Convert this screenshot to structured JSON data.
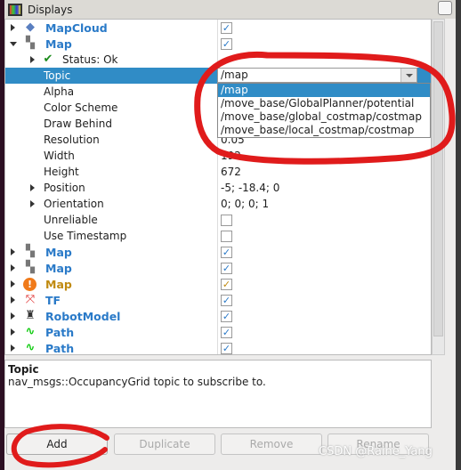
{
  "window": {
    "title": "Displays"
  },
  "tree": {
    "displays": [
      {
        "name": "MapCloud",
        "icon": "mapcloud-icon",
        "checked": true,
        "expanded": false
      },
      {
        "name": "Map",
        "icon": "map-grid-icon",
        "checked": true,
        "expanded": true
      }
    ],
    "status": "Status: Ok",
    "properties": [
      {
        "label": "Topic",
        "value": "/map"
      },
      {
        "label": "Alpha",
        "value": ""
      },
      {
        "label": "Color Scheme",
        "value": ""
      },
      {
        "label": "Draw Behind",
        "value": ""
      },
      {
        "label": "Resolution",
        "value": "0.05"
      },
      {
        "label": "Width",
        "value": "192"
      },
      {
        "label": "Height",
        "value": "672"
      },
      {
        "label": "Position",
        "value": "-5; -18.4; 0"
      },
      {
        "label": "Orientation",
        "value": "0; 0; 0; 1"
      },
      {
        "label": "Unreliable",
        "value": ""
      },
      {
        "label": "Use Timestamp",
        "value": ""
      }
    ],
    "more_displays": [
      {
        "name": "Map",
        "icon": "map-grid-icon",
        "checked": true,
        "warn": false
      },
      {
        "name": "Map",
        "icon": "map-grid-icon",
        "checked": true,
        "warn": false
      },
      {
        "name": "Map",
        "icon": "warning-icon",
        "checked": true,
        "warn": true
      },
      {
        "name": "TF",
        "icon": "tf-axes-icon",
        "checked": true,
        "warn": false
      },
      {
        "name": "RobotModel",
        "icon": "robot-icon",
        "checked": true,
        "warn": false
      },
      {
        "name": "Path",
        "icon": "path-icon",
        "checked": true,
        "warn": false
      },
      {
        "name": "Path",
        "icon": "path-icon",
        "checked": true,
        "warn": false
      }
    ]
  },
  "topic_dropdown": {
    "value": "/map",
    "options": [
      "/map",
      "/move_base/GlobalPlanner/potential",
      "/move_base/global_costmap/costmap",
      "/move_base/local_costmap/costmap"
    ],
    "selected_index": 0
  },
  "description": {
    "title": "Topic",
    "text": "nav_msgs::OccupancyGrid topic to subscribe to."
  },
  "buttons": {
    "add": "Add",
    "duplicate": "Duplicate",
    "remove": "Remove",
    "rename": "Rename"
  },
  "watermark": "CSDN @Raine_Yang",
  "colors": {
    "selection": "#308cc6",
    "display_name": "#2a7ac8",
    "warning": "#c08a10",
    "annotation": "#e01b1b"
  }
}
